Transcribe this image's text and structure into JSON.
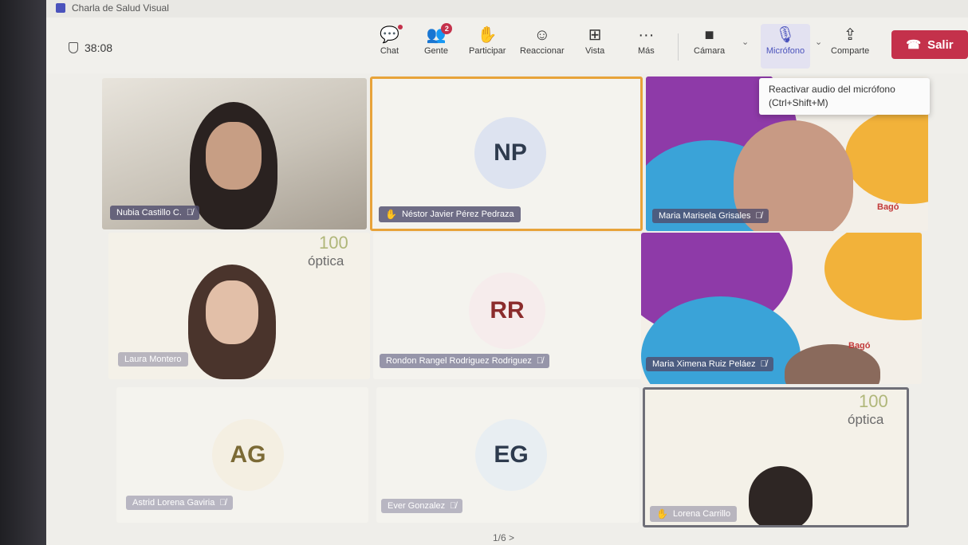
{
  "window": {
    "title": "Charla de Salud Visual"
  },
  "toolbar": {
    "timer": "38:08",
    "buttons": [
      {
        "label": "Chat",
        "icon": "chat-icon",
        "glyph": "💬"
      },
      {
        "label": "Gente",
        "icon": "people-icon",
        "glyph": "👥",
        "badge": "2"
      },
      {
        "label": "Participar",
        "icon": "raise-hand-icon",
        "glyph": "✋"
      },
      {
        "label": "Reaccionar",
        "icon": "smiley-icon",
        "glyph": "☺"
      },
      {
        "label": "Vista",
        "icon": "grid-view-icon",
        "glyph": "⊞"
      },
      {
        "label": "Más",
        "icon": "more-icon",
        "glyph": "···"
      },
      {
        "label": "Cámara",
        "icon": "camera-icon",
        "glyph": "■"
      },
      {
        "label": "Micrófono",
        "icon": "mic-off-icon",
        "glyph": "🎙"
      },
      {
        "label": "Comparte",
        "icon": "share-icon",
        "glyph": "⇪"
      }
    ],
    "leave_label": "Salir",
    "leave_color": "#c4314b"
  },
  "tooltip": {
    "line1": "Reactivar audio del micrófono",
    "line2": "(Ctrl+Shift+M)"
  },
  "participants": [
    {
      "name": "Nubia Castillo C.",
      "muted": true
    },
    {
      "name": "Néstor Javier Pérez Pedraza",
      "initials": "NP",
      "hand_raised": true,
      "speaking": true
    },
    {
      "name": "Maria Marisela Grisales",
      "muted": true
    },
    {
      "name": "Laura Montero"
    },
    {
      "name": "Rondon Rangel Rodriguez Rodriguez",
      "initials": "RR",
      "muted": true
    },
    {
      "name": "Maria Ximena Ruiz Peláez",
      "muted": true
    },
    {
      "name": "Astrid Lorena Gaviria",
      "initials": "AG",
      "muted": true
    },
    {
      "name": "Ever Gonzalez",
      "initials": "EG",
      "muted": true
    },
    {
      "name": "Lorena Carrillo",
      "hand_raised": true
    }
  ],
  "branding": {
    "logo_num": "100",
    "logo_text": "óptica",
    "bago": "Bagó"
  },
  "pager": "1/6  >"
}
